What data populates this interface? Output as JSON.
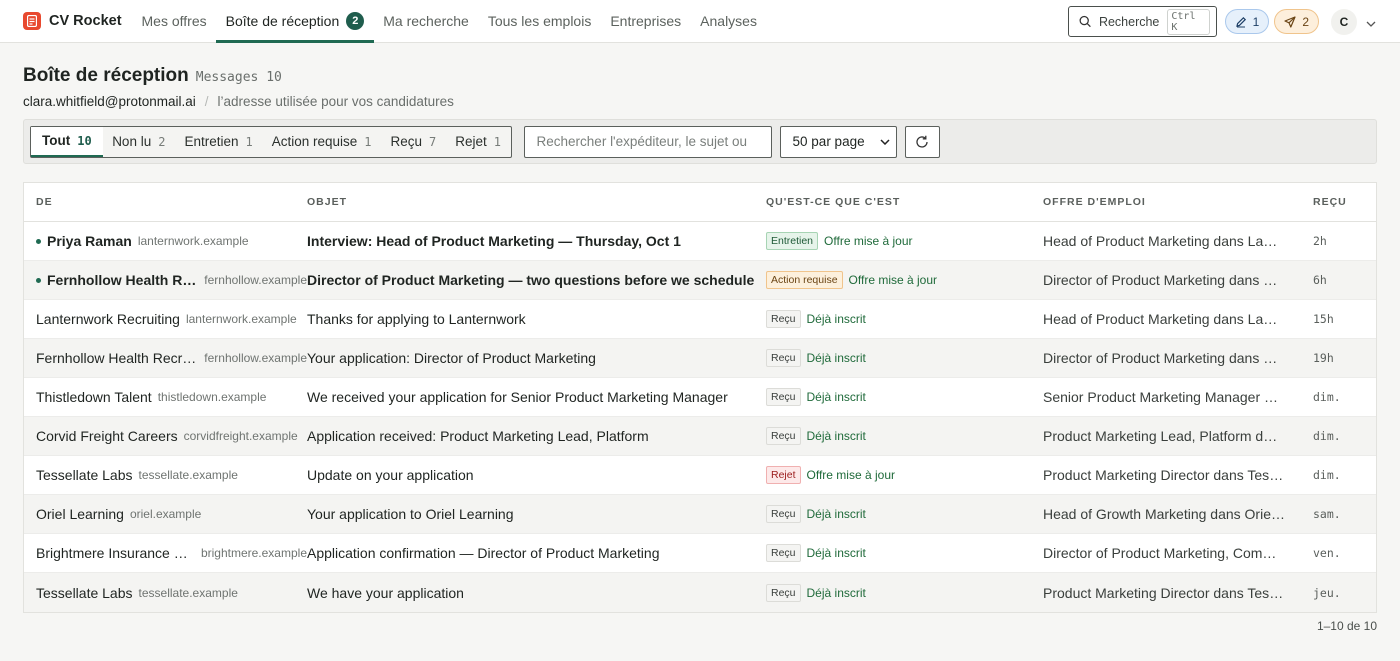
{
  "brand": {
    "name": "CV Rocket"
  },
  "nav": {
    "tabs": [
      {
        "label": "Mes offres",
        "active": false
      },
      {
        "label": "Boîte de réception",
        "active": true,
        "badge": "2"
      },
      {
        "label": "Ma recherche",
        "active": false
      },
      {
        "label": "Tous les emplois",
        "active": false
      },
      {
        "label": "Entreprises",
        "active": false
      },
      {
        "label": "Analyses",
        "active": false
      }
    ]
  },
  "topright": {
    "search_label": "Recherche",
    "search_shortcut": "Ctrl K",
    "drafts_count": "1",
    "sent_count": "2",
    "avatar_initial": "C"
  },
  "page": {
    "title": "Boîte de réception",
    "messages_count": "Messages 10",
    "email": "clara.whitfield@protonmail.ai",
    "email_separator": "/",
    "email_note": "l’adresse utilisée pour vos candidatures"
  },
  "filters": {
    "segments": [
      {
        "label": "Tout",
        "count": "10",
        "active": true
      },
      {
        "label": "Non lu",
        "count": "2",
        "active": false
      },
      {
        "label": "Entretien",
        "count": "1",
        "active": false
      },
      {
        "label": "Action requise",
        "count": "1",
        "active": false
      },
      {
        "label": "Reçu",
        "count": "7",
        "active": false
      },
      {
        "label": "Rejet",
        "count": "1",
        "active": false
      }
    ],
    "search_placeholder": "Rechercher l'expéditeur, le sujet ou",
    "per_page": "50 par page"
  },
  "table": {
    "headers": {
      "from": "DE",
      "subject": "OBJET",
      "what": "QU'EST-CE QUE C'EST",
      "job": "OFFRE D'EMPLOI",
      "received": "REÇU"
    },
    "rows": [
      {
        "unread": true,
        "sender": "Priya Raman",
        "domain": "lanternwork.example",
        "subject": "Interview: Head of Product Marketing — Thursday, Oct 1",
        "badge": "Entretien",
        "badge_kind": "entretien",
        "status": "Offre mise à jour",
        "job": "Head of Product Marketing dans Lanternwork",
        "time": "2h"
      },
      {
        "unread": true,
        "sender": "Fernhollow Health Recruiting",
        "domain": "fernhollow.example",
        "subject": "Director of Product Marketing — two questions before we schedule",
        "badge": "Action requise",
        "badge_kind": "action",
        "status": "Offre mise à jour",
        "job": "Director of Product Marketing dans Fernhollow Health",
        "time": "6h"
      },
      {
        "unread": false,
        "sender": "Lanternwork Recruiting",
        "domain": "lanternwork.example",
        "subject": "Thanks for applying to Lanternwork",
        "badge": "Reçu",
        "badge_kind": "recu",
        "status": "Déjà inscrit",
        "job": "Head of Product Marketing dans Lanternwork",
        "time": "15h"
      },
      {
        "unread": false,
        "sender": "Fernhollow Health Recruiting",
        "domain": "fernhollow.example",
        "subject": "Your application: Director of Product Marketing",
        "badge": "Reçu",
        "badge_kind": "recu",
        "status": "Déjà inscrit",
        "job": "Director of Product Marketing dans Fernhollow Health",
        "time": "19h"
      },
      {
        "unread": false,
        "sender": "Thistledown Talent",
        "domain": "thistledown.example",
        "subject": "We received your application for Senior Product Marketing Manager",
        "badge": "Reçu",
        "badge_kind": "recu",
        "status": "Déjà inscrit",
        "job": "Senior Product Marketing Manager dans Thistledown",
        "time": "dim."
      },
      {
        "unread": false,
        "sender": "Corvid Freight Careers",
        "domain": "corvidfreight.example",
        "subject": "Application received: Product Marketing Lead, Platform",
        "badge": "Reçu",
        "badge_kind": "recu",
        "status": "Déjà inscrit",
        "job": "Product Marketing Lead, Platform dans Corvid Freight",
        "time": "dim."
      },
      {
        "unread": false,
        "sender": "Tessellate Labs",
        "domain": "tessellate.example",
        "subject": "Update on your application",
        "badge": "Rejet",
        "badge_kind": "rejet",
        "status": "Offre mise à jour",
        "job": "Product Marketing Director dans Tessellate Labs",
        "time": "dim."
      },
      {
        "unread": false,
        "sender": "Oriel Learning",
        "domain": "oriel.example",
        "subject": "Your application to Oriel Learning",
        "badge": "Reçu",
        "badge_kind": "recu",
        "status": "Déjà inscrit",
        "job": "Head of Growth Marketing dans Oriel Learning",
        "time": "sam."
      },
      {
        "unread": false,
        "sender": "Brightmere Insurance Careers",
        "domain": "brightmere.example",
        "subject": "Application confirmation — Director of Product Marketing",
        "badge": "Reçu",
        "badge_kind": "recu",
        "status": "Déjà inscrit",
        "job": "Director of Product Marketing, Commercial dans Brightmere",
        "time": "ven."
      },
      {
        "unread": false,
        "sender": "Tessellate Labs",
        "domain": "tessellate.example",
        "subject": "We have your application",
        "badge": "Reçu",
        "badge_kind": "recu",
        "status": "Déjà inscrit",
        "job": "Product Marketing Director dans Tessellate Labs",
        "time": "jeu."
      }
    ]
  },
  "pagination": {
    "label": "1–10 de 10"
  },
  "colors": {
    "accent": "#1f6a52",
    "brand": "#e8492f"
  }
}
